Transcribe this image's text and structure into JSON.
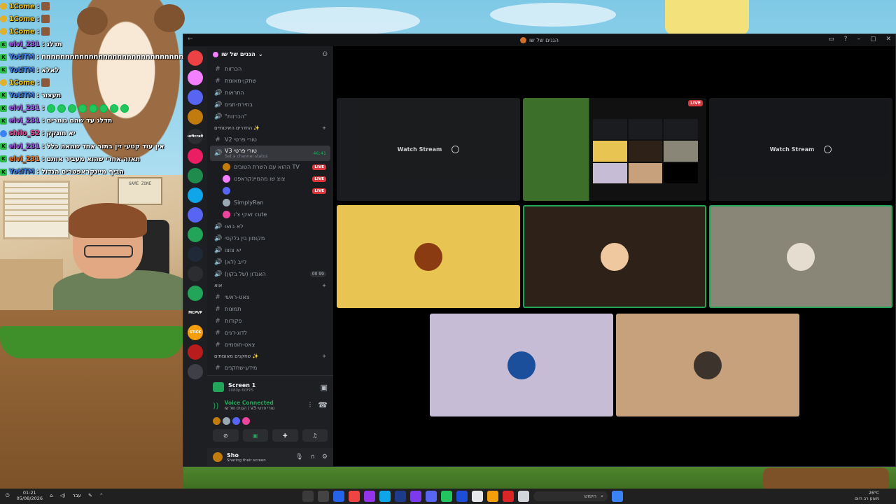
{
  "chat": [
    {
      "user": "1Come",
      "message": "",
      "badge": "c",
      "color": "#f0c419",
      "emote": "brown"
    },
    {
      "user": "1Come",
      "message": "",
      "badge": "c",
      "color": "#f0c419",
      "emote": "brown"
    },
    {
      "user": "1Come",
      "message": "",
      "badge": "c",
      "color": "#f0c419",
      "emote": "brown"
    },
    {
      "user": "elvi_231",
      "message": "תדלג",
      "badge": "k",
      "color": "#a855f7",
      "emote": ""
    },
    {
      "user": "YotiTM",
      "message": "nnnnnnnnnnnnnnnnnnnnnnnnnnnnnn",
      "badge": "k",
      "color": "#3b82f6",
      "emote": ""
    },
    {
      "user": "YotiTM",
      "message": "לאלא",
      "badge": "k",
      "color": "#3b82f6",
      "emote": ""
    },
    {
      "user": "1Come",
      "message": "",
      "badge": "c",
      "color": "#f0c419",
      "emote": "brown"
    },
    {
      "user": "YotiTM",
      "message": "תעצור",
      "badge": "k",
      "color": "#3b82f6",
      "emote": ""
    },
    {
      "user": "elvi_231",
      "message": "",
      "badge": "k",
      "color": "#a855f7",
      "emote": "green"
    },
    {
      "user": "elvi_231",
      "message": "תדלג עד שהם גומרים",
      "badge": "k",
      "color": "#a855f7",
      "emote": ""
    },
    {
      "user": "shilo_S2",
      "message": "יא חונקק",
      "badge": "b",
      "color": "#ec4899",
      "emote": ""
    },
    {
      "user": "elvi_231",
      "message": "אין עוד קטעי זין בתור אחד שהאה כלל",
      "badge": "k",
      "color": "#a855f7",
      "emote": ""
    },
    {
      "user": "elvi_231",
      "message": "תאזה אחרי שהוא מעביר אותם",
      "badge": "k",
      "color": "#f97316",
      "emote": ""
    },
    {
      "user": "YotiTM",
      "message": "הביף מיינקראפטרים הנדול",
      "badge": "k",
      "color": "#3b82f6",
      "emote": ""
    }
  ],
  "webcam": {
    "sign_text": "GAME ZONE"
  },
  "window": {
    "title": "הגנים של שו"
  },
  "guild": {
    "name": "הגנים של שו"
  },
  "servers": [
    {
      "color": "#ed4245",
      "label": ""
    },
    {
      "color": "#f47fff",
      "label": ""
    },
    {
      "color": "#5865f2",
      "label": ""
    },
    {
      "color": "#c27c0e",
      "label": ""
    },
    {
      "color": "#2b2d31",
      "label": "softcraft"
    },
    {
      "color": "#e91e63",
      "label": ""
    },
    {
      "color": "#1f8b4c",
      "label": ""
    },
    {
      "color": "#0ea5e9",
      "label": ""
    },
    {
      "color": "#5865f2",
      "label": ""
    },
    {
      "color": "#23a559",
      "label": ""
    },
    {
      "color": "#1f2937",
      "label": ""
    },
    {
      "color": "#2b2d31",
      "label": ""
    },
    {
      "color": "#23a559",
      "label": ""
    },
    {
      "color": "#1e1f22",
      "label": "MCPVP"
    },
    {
      "color": "#f59e0b",
      "label": "STICK"
    },
    {
      "color": "#b91c1c",
      "label": ""
    },
    {
      "color": "#3f3f46",
      "label": ""
    }
  ],
  "channels": [
    {
      "kind": "text",
      "name": "הכרזות",
      "sub": "",
      "extra": ""
    },
    {
      "kind": "text",
      "name": "שתקן-מאומת",
      "sub": "",
      "extra": ""
    },
    {
      "kind": "voice",
      "name": "התראות",
      "sub": "",
      "extra": ""
    },
    {
      "kind": "voice",
      "name": "בחירת-תגים",
      "sub": "",
      "extra": ""
    },
    {
      "kind": "voice",
      "name": "\"הכרזות\"",
      "sub": "",
      "extra": ""
    },
    {
      "kind": "cat",
      "name": "החדרים האיכותיים ✨",
      "sub": "",
      "extra": "+"
    },
    {
      "kind": "text",
      "name": "V2 טורי פרטי",
      "sub": "",
      "extra": ""
    },
    {
      "kind": "active",
      "name": "V3 טורי פרטי",
      "sub": "Set a channel status",
      "extra": "46:41"
    },
    {
      "kind": "user",
      "name": "ההוא עם השרת הטובים TV",
      "sub": "",
      "extra": "LIVE",
      "color": "#c27c0e"
    },
    {
      "kind": "user",
      "name": "צוצ שו מהמיינקראפט",
      "sub": "",
      "extra": "LIVE",
      "color": "#f47fff"
    },
    {
      "kind": "user",
      "name": "",
      "sub": "",
      "extra": "LIVE",
      "color": "#5865f2"
    },
    {
      "kind": "user",
      "name": "SimplyRan",
      "sub": "",
      "extra": "",
      "color": "#99aab5"
    },
    {
      "kind": "user",
      "name": "זאקי צ'ו cute",
      "sub": "",
      "extra": "",
      "color": "#eb459e"
    },
    {
      "kind": "voice",
      "name": "לא בואו",
      "sub": "",
      "extra": ""
    },
    {
      "kind": "voice",
      "name": "מקומון בין גלקסי",
      "sub": "",
      "extra": ""
    },
    {
      "kind": "voice",
      "name": "יא צוצו",
      "sub": "",
      "extra": ""
    },
    {
      "kind": "voice",
      "name": "לייב (לא)",
      "sub": "",
      "extra": ""
    },
    {
      "kind": "voice",
      "name": "האגדון (של בקון)",
      "sub": "",
      "extra": "00 99"
    },
    {
      "kind": "cat",
      "name": "אוא",
      "sub": "",
      "extra": "+"
    },
    {
      "kind": "text",
      "name": "צאט-ראשי",
      "sub": "",
      "extra": ""
    },
    {
      "kind": "text",
      "name": "תמונות",
      "sub": "",
      "extra": ""
    },
    {
      "kind": "text",
      "name": "פקודות",
      "sub": "",
      "extra": ""
    },
    {
      "kind": "text",
      "name": "לדוג-דגים",
      "sub": "",
      "extra": ""
    },
    {
      "kind": "text",
      "name": "צאט-חוסמים",
      "sub": "",
      "extra": ""
    },
    {
      "kind": "cat",
      "name": "שחקנים מאומתים ✨",
      "sub": "",
      "extra": "+"
    },
    {
      "kind": "text",
      "name": "מידע-שחקנים",
      "sub": "",
      "extra": ""
    }
  ],
  "panel": {
    "screen_title": "Screen 1",
    "screen_sub": "1080p 60FPS",
    "voice_status": "Voice Connected",
    "voice_channel": "הגנים של שו / V3 טורי פרטי",
    "user_name": "Sho",
    "user_status": "Sharing their screen"
  },
  "stage": {
    "watch_label": "Watch Stream",
    "live_label": "LIVE",
    "tiles": [
      {
        "kind": "stream",
        "bg": "#1f2124",
        "watch": true
      },
      {
        "kind": "livestream",
        "bg": "#2b4a2a",
        "watch": false
      },
      {
        "kind": "stream",
        "bg": "#1b1c1f",
        "watch": true
      },
      {
        "kind": "avatar",
        "bg": "#e8c452",
        "av": "#8a3b12",
        "speaking": false
      },
      {
        "kind": "avatar",
        "bg": "#2e2218",
        "av": "#f0c8a0",
        "speaking": true
      },
      {
        "kind": "avatar",
        "bg": "#8a8677",
        "av": "#e5ddd0",
        "speaking": true
      },
      {
        "kind": "avatar",
        "bg": "#c7bcd6",
        "av": "#1b4e9b",
        "speaking": false
      },
      {
        "kind": "avatar",
        "bg": "#c7a07c",
        "av": "#3b332c",
        "speaking": false
      }
    ]
  },
  "taskbar": {
    "time": "01:21",
    "date": "05/08/2026",
    "lang": "עבר",
    "search": "חיפוש",
    "weather_temp": "26°C",
    "weather_desc": "מעונן רב היום"
  }
}
